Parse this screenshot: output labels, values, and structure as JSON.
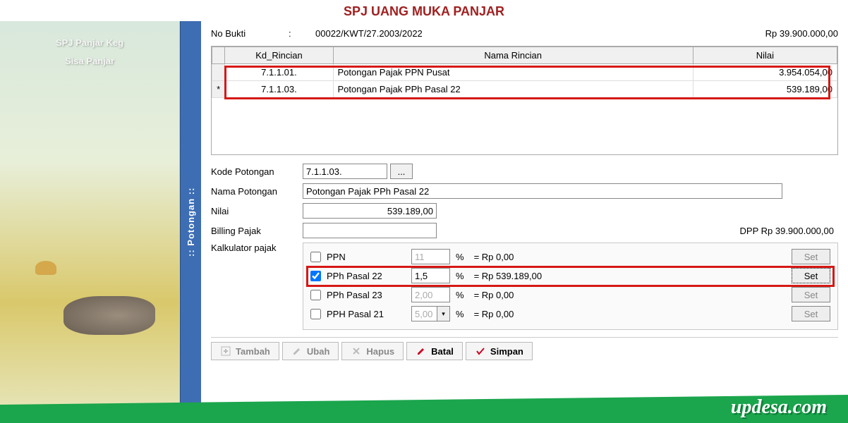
{
  "title": "SPJ UANG MUKA PANJAR",
  "sidebar": {
    "line1": "SPJ Panjar Keg",
    "line2": "Sisa Panjar"
  },
  "vtab": ":: Potongan ::",
  "header": {
    "label": "No Bukti",
    "colon": ":",
    "value": "00022/KWT/27.2003/2022",
    "amount": "Rp 39.900.000,00"
  },
  "grid": {
    "headers": {
      "kd": "Kd_Rincian",
      "nama": "Nama Rincian",
      "nilai": "Nilai"
    },
    "rows": [
      {
        "ind": " ",
        "kd": "7.1.1.01.",
        "nama": "Potongan Pajak PPN Pusat",
        "nilai": "3.954.054,00"
      },
      {
        "ind": "*",
        "kd": "7.1.1.03.",
        "nama": "Potongan Pajak PPh Pasal 22",
        "nilai": "539.189,00"
      }
    ]
  },
  "form": {
    "kode_label": "Kode Potongan",
    "kode_value": "7.1.1.03.",
    "browse": "...",
    "nama_label": "Nama Potongan",
    "nama_value": "Potongan Pajak PPh Pasal 22",
    "nilai_label": "Nilai",
    "nilai_value": "539.189,00",
    "billing_label": "Billing Pajak",
    "billing_value": "",
    "dpp": "DPP  Rp 39.900.000,00",
    "kalk_label": "Kalkulator pajak"
  },
  "calc": {
    "pct": "%",
    "set": "Set",
    "rows": [
      {
        "checked": false,
        "name": "PPN",
        "rate": "11",
        "result": "= Rp 0,00",
        "active": false
      },
      {
        "checked": true,
        "name": "PPh Pasal 22",
        "rate": "1,5",
        "result": "= Rp 539.189,00",
        "active": true
      },
      {
        "checked": false,
        "name": "PPh Pasal 23",
        "rate": "2,00",
        "result": "= Rp 0,00",
        "active": false
      },
      {
        "checked": false,
        "name": "PPH Pasal 21",
        "rate": "5,00",
        "result": "= Rp 0,00",
        "active": false,
        "dropdown": true
      }
    ]
  },
  "toolbar": {
    "tambah": "Tambah",
    "ubah": "Ubah",
    "hapus": "Hapus",
    "batal": "Batal",
    "simpan": "Simpan"
  },
  "watermark": "updesa.com"
}
